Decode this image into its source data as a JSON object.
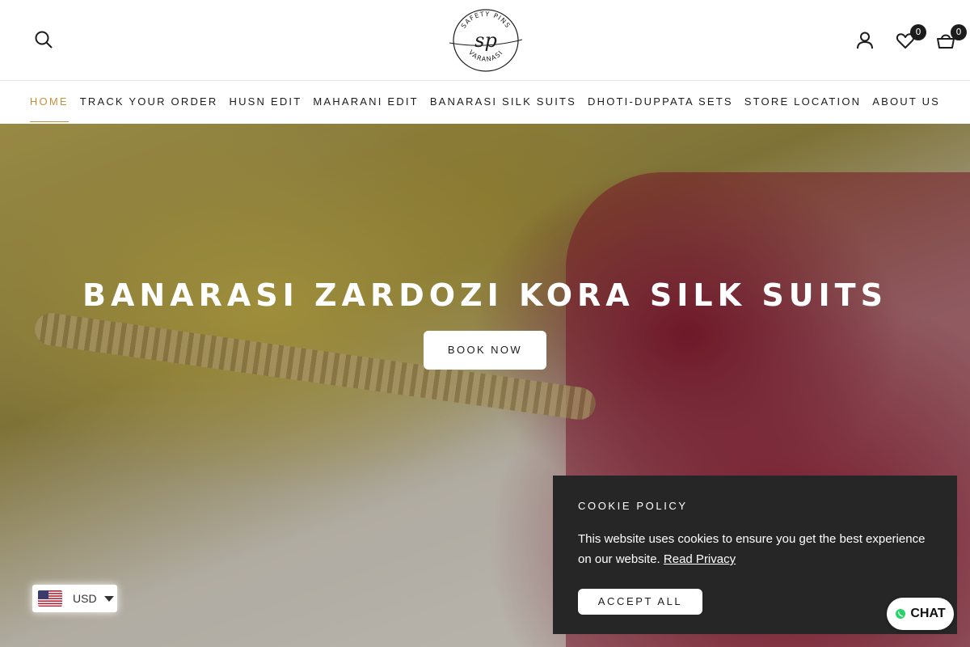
{
  "header": {
    "logo": {
      "top_text": "SAFETY PINS",
      "monogram": "sp",
      "bottom_text": "VARANASI"
    },
    "wishlist_count": "0",
    "cart_count": "0"
  },
  "nav": {
    "items": [
      {
        "label": "HOME",
        "active": true
      },
      {
        "label": "TRACK YOUR ORDER"
      },
      {
        "label": "HUSN EDIT"
      },
      {
        "label": "MAHARANI EDIT"
      },
      {
        "label": "BANARASI SILK SUITS"
      },
      {
        "label": "DHOTI-DUPPATA SETS"
      },
      {
        "label": "STORE LOCATION"
      },
      {
        "label": "ABOUT US"
      }
    ]
  },
  "hero": {
    "title": "BANARASI ZARDOZI KORA SILK SUITS",
    "button_label": "BOOK NOW"
  },
  "currency": {
    "code": "USD"
  },
  "cookie": {
    "title": "COOKIE POLICY",
    "text": "This website uses cookies to ensure you get the best experience on our website.",
    "link_label": "Read Privacy",
    "accept_label": "ACCEPT ALL"
  },
  "chat": {
    "label": "CHAT"
  },
  "colors": {
    "accent": "#c4913b",
    "dark": "#1c1c1c",
    "cookie_bg": "#262626",
    "whatsapp": "#25d366"
  }
}
